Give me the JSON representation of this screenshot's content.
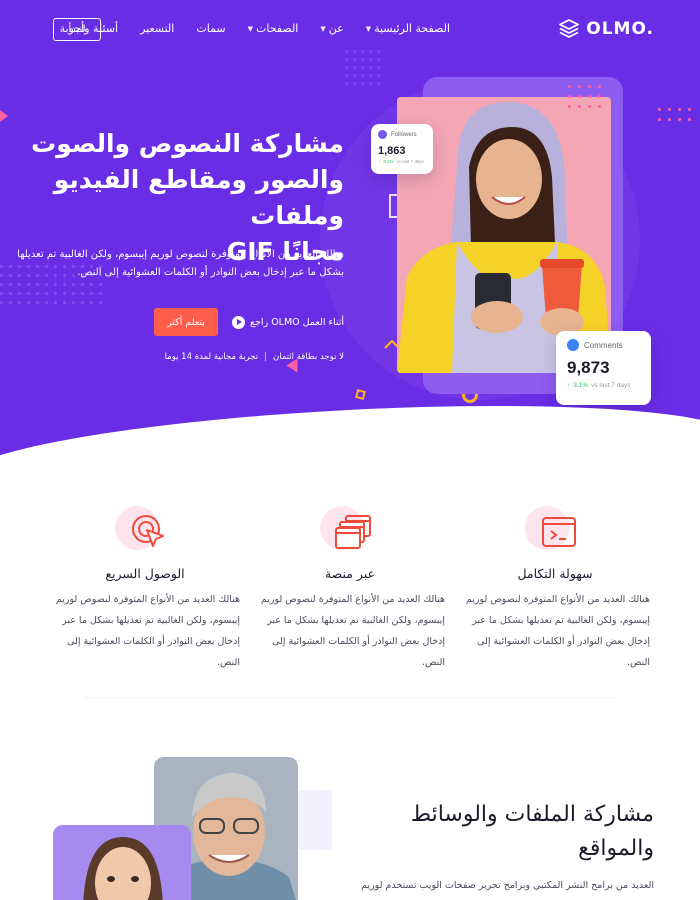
{
  "brand": {
    "name": "OLMO.",
    "primary": "#6a2de6",
    "accent": "#ff5f4a"
  },
  "nav": {
    "links": [
      {
        "label": "الصفحة الرئيسية",
        "has_dropdown": true
      },
      {
        "label": "عن",
        "has_dropdown": true
      },
      {
        "label": "الصفحات",
        "has_dropdown": true
      },
      {
        "label": "سمات",
        "has_dropdown": false
      },
      {
        "label": "التسعير",
        "has_dropdown": false
      },
      {
        "label": "أسئلة وأجوبة",
        "has_dropdown": false
      }
    ],
    "start_label": "لنبدأ"
  },
  "hero": {
    "title_line1": "مشاركة النصوص والصوت",
    "title_line2": "والصور ومقاطع الفيديو وملفات",
    "title_line3": "مجانًا GIF",
    "description": "هنالك العديد من الأنواع المتوفرة لنصوص لوريم إيبسوم، ولكن الغالبية تم تعديلها بشكل ما عبر إدخال بعض النوادر أو الكلمات العشوائية إلى النص.",
    "learn_more": "يتعلم أكثر",
    "watch_label": "أثناء العمل OLMO راجع",
    "trial": "تجربة مجانية لمدة 14 يوما",
    "no_card": "لا توجد بطاقة ائتمان"
  },
  "followers_card": {
    "label": "Followers",
    "value": "1,863",
    "change": "3.1%",
    "period": "vs last 7 days"
  },
  "comments_card": {
    "label": "Comments",
    "value": "9,873",
    "change": "3.1%",
    "period": "vs last 7 days"
  },
  "features": [
    {
      "icon": "terminal-icon",
      "title": "سهولة التكامل",
      "desc": "هنالك العديد من الأنواع المتوفرة لنصوص لوريم إيبسوم، ولكن الغالبية تم تعديلها بشكل ما عبر إدخال بعض النوادر أو الكلمات العشوائية إلى النص."
    },
    {
      "icon": "windows-icon",
      "title": "عبر منصة",
      "desc": "هنالك العديد من الأنواع المتوفرة لنصوص لوريم إيبسوم، ولكن الغالبية تم تعديلها بشكل ما عبر إدخال بعض النوادر أو الكلمات العشوائية إلى النص."
    },
    {
      "icon": "target-cursor-icon",
      "title": "الوصول السريع",
      "desc": "هنالك العديد من الأنواع المتوفرة لنصوص لوريم إيبسوم، ولكن الغالبية تم تعديلها بشكل ما عبر إدخال بعض النوادر أو الكلمات العشوائية إلى النص."
    }
  ],
  "section3": {
    "title_line1": "مشاركة الملفات والوسائط",
    "title_line2": "والمواقع",
    "desc": "العديد من برامح النشر المكتبي وبرامح تحرير صفحات الويب تستخدم لوريم"
  }
}
